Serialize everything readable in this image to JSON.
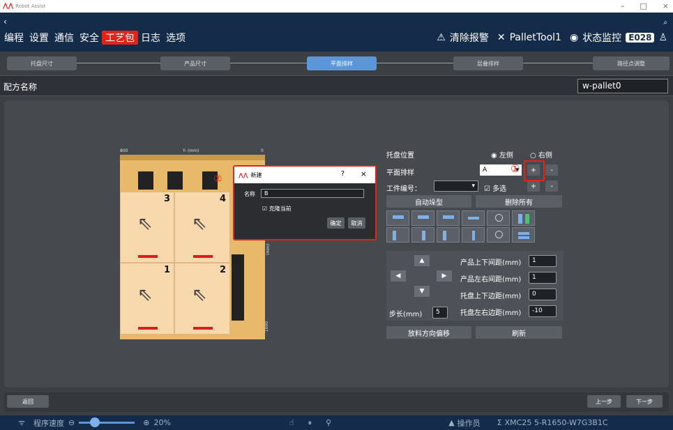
{
  "app": {
    "title": "Robot Assist",
    "min": "–",
    "max": "□",
    "close": "×"
  },
  "nav": {
    "back": "‹",
    "menu": [
      "编程",
      "设置",
      "通信",
      "安全",
      "工艺包",
      "日志",
      "选项"
    ],
    "active_index": 4,
    "clear_alarm": "清除报警",
    "tool": "PalletTool1",
    "monitor": "状态监控",
    "code": "E028"
  },
  "steps": [
    "托盘尺寸",
    "产品尺寸",
    "平面排样",
    "层叠排样",
    "路径点调整"
  ],
  "active_step": 2,
  "recipe": {
    "label": "配方名称",
    "value": "w-pallet0"
  },
  "pallet": {
    "axis_left": "800",
    "axis_mid": "Y- (mm)",
    "axis_right": "0",
    "axis_bottom": "1000",
    "axis_side": "X+ (mm)",
    "boxes": [
      "3",
      "4",
      "1",
      "2"
    ]
  },
  "dialog": {
    "title": "新建",
    "help": "?",
    "close": "×",
    "name_label": "名称",
    "name_value": "B",
    "clone_label": "克隆当前",
    "ok": "确定",
    "cancel": "取消"
  },
  "annotations": {
    "one": "①",
    "two": "②"
  },
  "right": {
    "pallet_position": "托盘位置",
    "left_side": "左侧",
    "right_side": "右侧",
    "layout": "平面排样",
    "layout_value": "A",
    "workpiece": "工件编号：",
    "multi": "多选",
    "auto_stack": "自动垛型",
    "delete_all": "删除所有",
    "gap_v": "产品上下间距(mm)",
    "gap_v_val": "1",
    "gap_h": "产品左右间距(mm)",
    "gap_h_val": "1",
    "margin_v": "托盘上下边距(mm)",
    "margin_v_val": "0",
    "margin_h": "托盘左右边距(mm)",
    "margin_h_val": "-10",
    "step_label": "步长(mm)",
    "step_val": "5",
    "offset": "放料方向偏移",
    "refresh": "刷新",
    "plus": "+",
    "minus": "-"
  },
  "bottom": {
    "back": "返回",
    "prev": "上一步",
    "next": "下一步"
  },
  "status": {
    "speed_label": "程序速度",
    "speed": "20%",
    "user": "操作员",
    "device": "XMC25 5-R1650-W7G3B1C"
  }
}
